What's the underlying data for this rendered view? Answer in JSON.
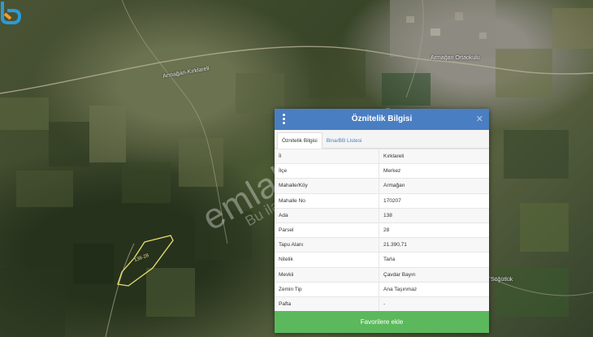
{
  "map": {
    "place_labels": [
      "Armağan-Kırklareli",
      "Armağan Ortaokulu",
      "Söğütlük"
    ],
    "parcel_label": "138-28"
  },
  "watermark": {
    "main": "emlakjet.com",
    "sub": "Bu ilan"
  },
  "panel": {
    "title": "Öznitelik Bilgisi",
    "close_symbol": "✕",
    "tabs": [
      {
        "label": "Öznitelik Bilgisi",
        "active": true
      },
      {
        "label": "Bina/BB Listesi",
        "active": false
      }
    ],
    "rows": [
      {
        "key": "İl",
        "value": "Kırklareli"
      },
      {
        "key": "İlçe",
        "value": "Merkez"
      },
      {
        "key": "Mahalle/Köy",
        "value": "Armağan"
      },
      {
        "key": "Mahalle No",
        "value": "170207"
      },
      {
        "key": "Ada",
        "value": "138"
      },
      {
        "key": "Parsel",
        "value": "28"
      },
      {
        "key": "Tapu Alanı",
        "value": "21.390,71"
      },
      {
        "key": "Nitelik",
        "value": "Tarla"
      },
      {
        "key": "Mevkii",
        "value": "Çavdar Bayırı"
      },
      {
        "key": "Zemin Tip",
        "value": "Ana Taşınmaz"
      },
      {
        "key": "Pafta",
        "value": "-"
      }
    ],
    "favorite_button": "Favorilere ekle"
  },
  "colors": {
    "header": "#4a7ec2",
    "button": "#5cb85c"
  }
}
